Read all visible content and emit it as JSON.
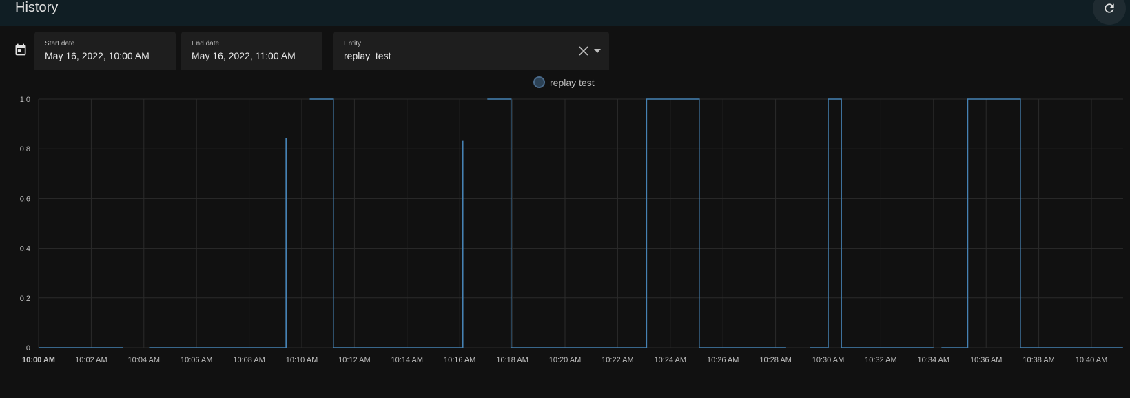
{
  "header": {
    "title": "History",
    "refresh_icon": "refresh-icon"
  },
  "filters": {
    "calendar_icon": "calendar-icon",
    "start_date": {
      "label": "Start date",
      "value": "May 16, 2022, 10:00 AM"
    },
    "end_date": {
      "label": "End date",
      "value": "May 16, 2022, 11:00 AM"
    },
    "entity": {
      "label": "Entity",
      "value": "replay_test",
      "clear_icon": "close-icon",
      "dropdown_icon": "caret-down-icon"
    }
  },
  "colors": {
    "series": "#4682b4",
    "grid": "#2b2b2b",
    "axis_text": "#bdbdbd"
  },
  "chart_data": {
    "type": "line",
    "step": true,
    "legend": {
      "position": "top",
      "entries": [
        "replay test"
      ]
    },
    "ylim": [
      0,
      1.0
    ],
    "yticks": [
      "0",
      "0.2",
      "0.4",
      "0.6",
      "0.8",
      "1.0"
    ],
    "xticks": [
      "10:00 AM",
      "10:02 AM",
      "10:04 AM",
      "10:06 AM",
      "10:08 AM",
      "10:10 AM",
      "10:12 AM",
      "10:14 AM",
      "10:16 AM",
      "10:18 AM",
      "10:20 AM",
      "10:22 AM",
      "10:24 AM",
      "10:26 AM",
      "10:28 AM",
      "10:30 AM",
      "10:32 AM",
      "10:34 AM",
      "10:36 AM",
      "10:38 AM",
      "10:40 AM"
    ],
    "xlim_minutes": [
      0,
      41.2
    ],
    "series": [
      {
        "name": "replay test",
        "segments": [
          [
            [
              0,
              0
            ],
            [
              3.2,
              0
            ]
          ],
          [
            [
              4.2,
              0
            ],
            [
              9.4,
              0
            ],
            [
              9.4,
              0.84
            ],
            [
              9.42,
              0.84
            ],
            [
              9.42,
              0
            ]
          ],
          [
            [
              10.3,
              1
            ],
            [
              11.2,
              1
            ],
            [
              11.2,
              0
            ],
            [
              16.1,
              0
            ],
            [
              16.1,
              0.83
            ],
            [
              16.12,
              0.83
            ],
            [
              16.12,
              0
            ]
          ],
          [
            [
              17.05,
              1
            ],
            [
              17.95,
              1
            ],
            [
              17.95,
              0
            ],
            [
              23.1,
              0
            ],
            [
              23.1,
              1
            ],
            [
              25.1,
              1
            ],
            [
              25.1,
              0
            ],
            [
              28.4,
              0
            ]
          ],
          [
            [
              29.3,
              0
            ],
            [
              30,
              0
            ],
            [
              30,
              1
            ],
            [
              30.5,
              1
            ],
            [
              30.5,
              0
            ],
            [
              34.0,
              0
            ]
          ],
          [
            [
              34.3,
              0
            ],
            [
              35.3,
              0
            ],
            [
              35.3,
              1
            ],
            [
              37.3,
              1
            ],
            [
              37.3,
              0
            ],
            [
              41.2,
              0
            ]
          ]
        ]
      }
    ]
  }
}
